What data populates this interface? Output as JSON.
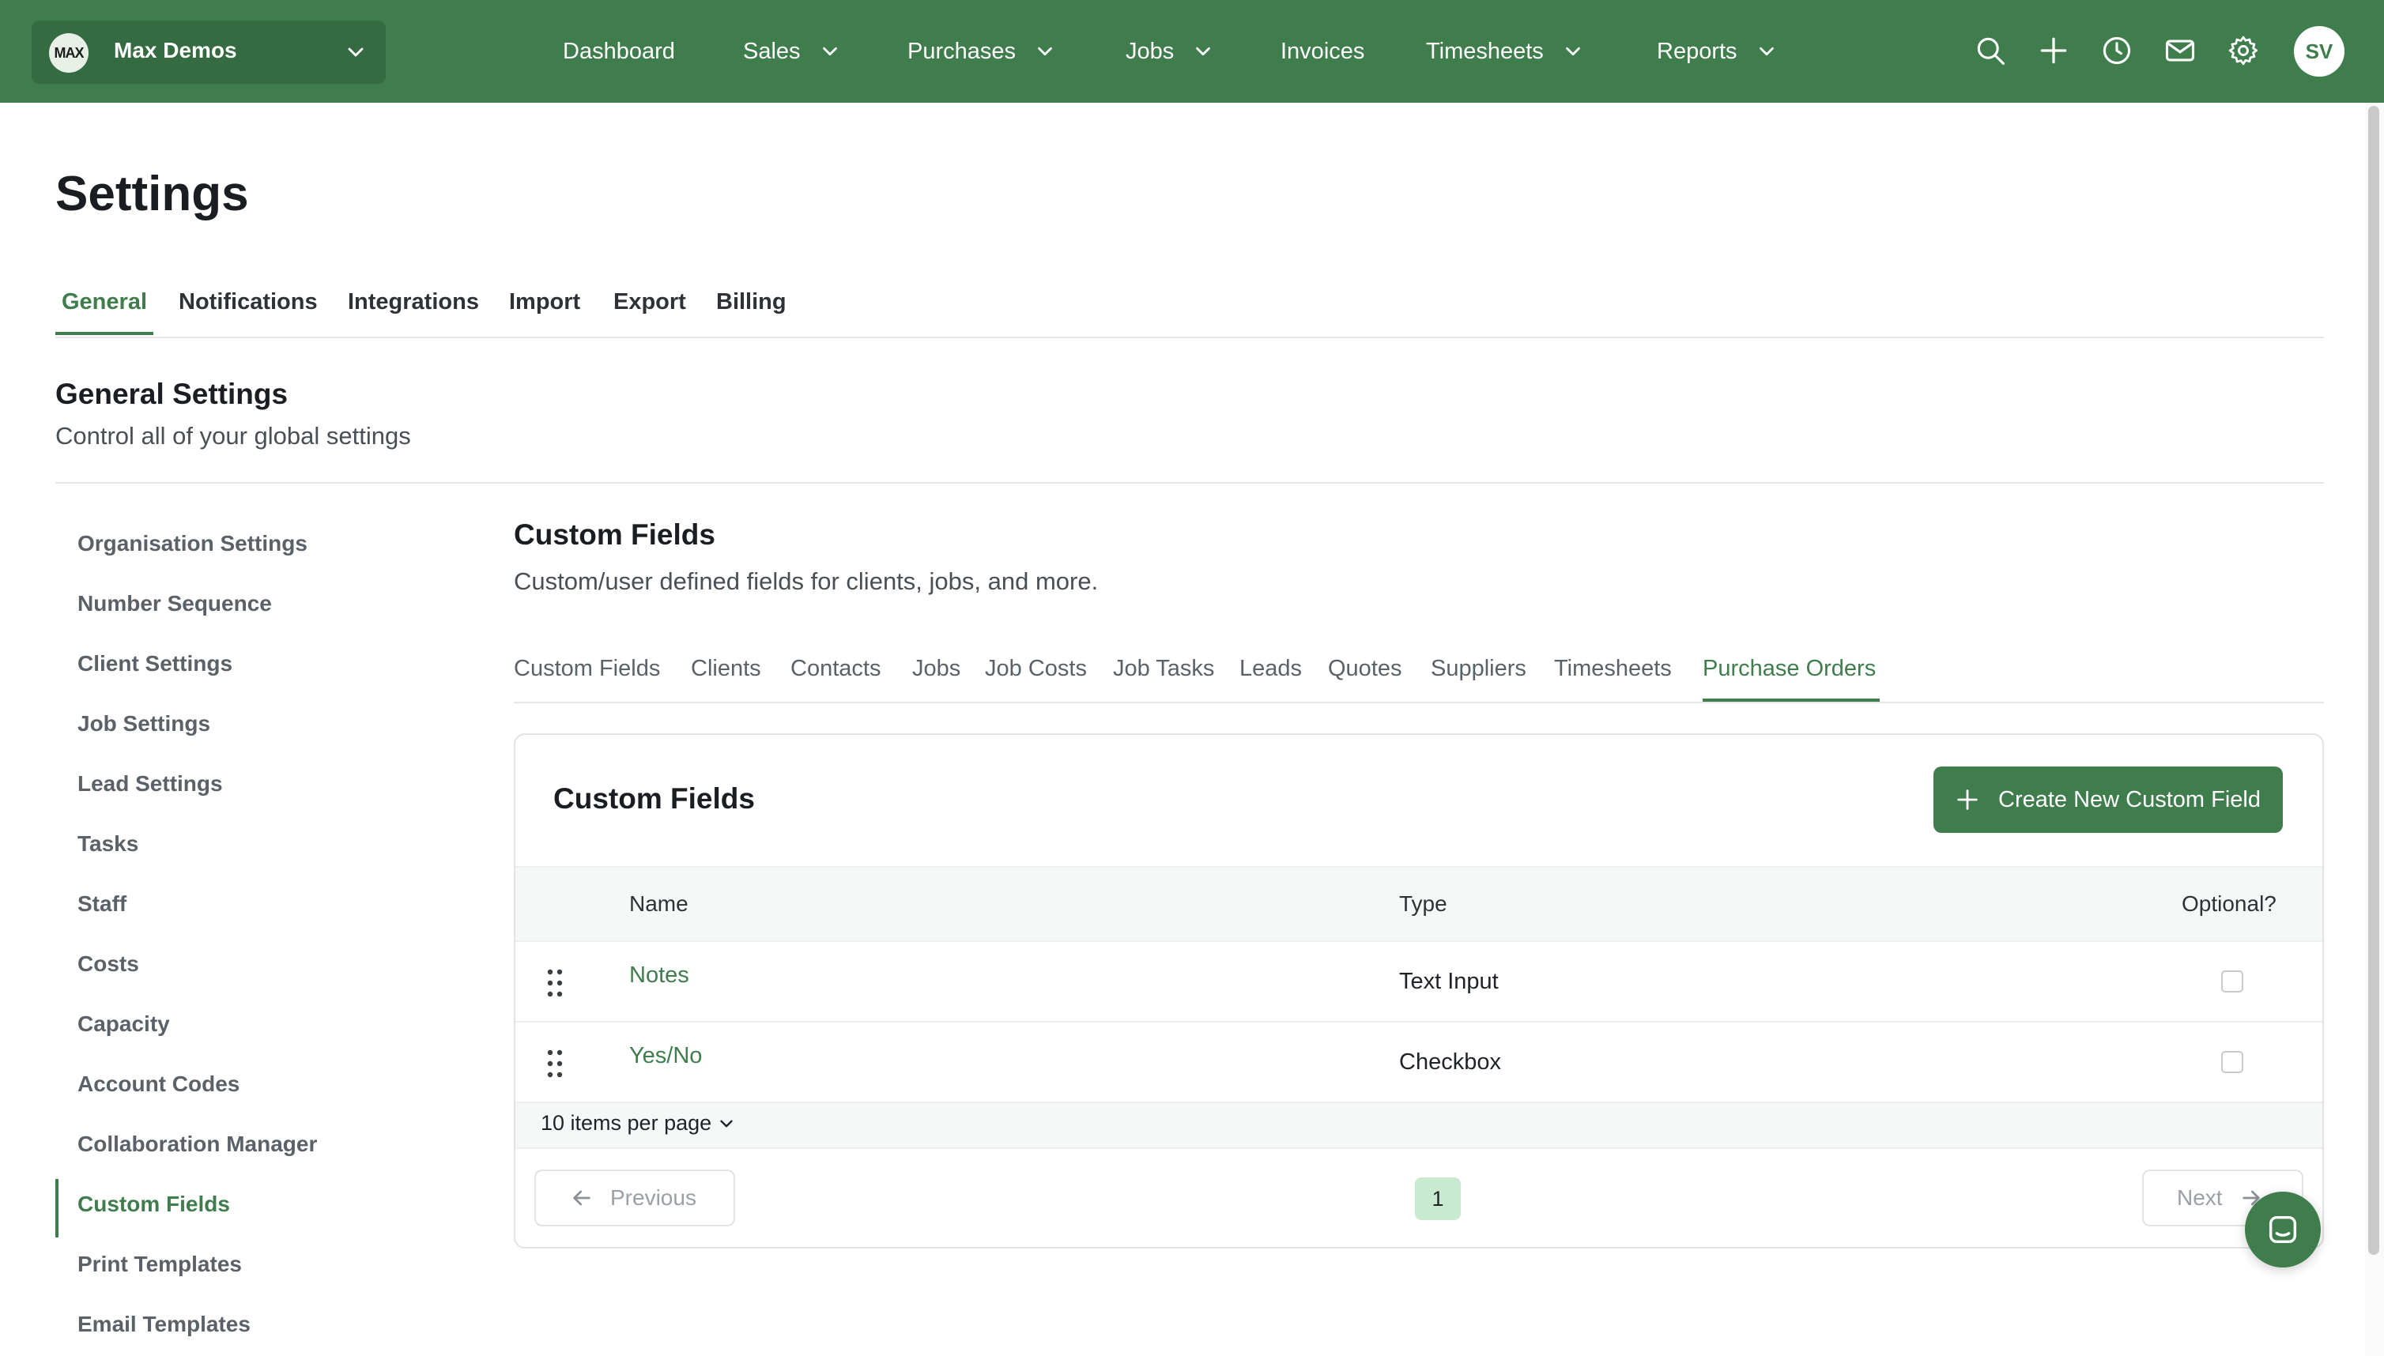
{
  "topbar": {
    "org_logo_text": "MAX",
    "org_name": "Max Demos",
    "nav": [
      {
        "label": "Dashboard",
        "dropdown": false
      },
      {
        "label": "Sales",
        "dropdown": true
      },
      {
        "label": "Purchases",
        "dropdown": true
      },
      {
        "label": "Jobs",
        "dropdown": true
      },
      {
        "label": "Invoices",
        "dropdown": false
      },
      {
        "label": "Timesheets",
        "dropdown": true
      },
      {
        "label": "Reports",
        "dropdown": true
      }
    ],
    "icons": [
      "search-icon",
      "plus-icon",
      "clock-icon",
      "mail-icon",
      "gear-icon"
    ],
    "avatar_initials": "SV",
    "bar_color": "#3f7d4d"
  },
  "page": {
    "title": "Settings",
    "tabs": [
      {
        "label": "General",
        "active": true
      },
      {
        "label": "Notifications"
      },
      {
        "label": "Integrations"
      },
      {
        "label": "Import"
      },
      {
        "label": "Export"
      },
      {
        "label": "Billing"
      }
    ],
    "section_title": "General Settings",
    "section_subtitle": "Control all of your global settings"
  },
  "sidebar": {
    "items": [
      {
        "label": "Organisation Settings"
      },
      {
        "label": "Number Sequence"
      },
      {
        "label": "Client Settings"
      },
      {
        "label": "Job Settings"
      },
      {
        "label": "Lead Settings"
      },
      {
        "label": "Tasks"
      },
      {
        "label": "Staff"
      },
      {
        "label": "Costs"
      },
      {
        "label": "Capacity"
      },
      {
        "label": "Account Codes"
      },
      {
        "label": "Collaboration Manager"
      },
      {
        "label": "Custom Fields",
        "active": true
      },
      {
        "label": "Print Templates"
      },
      {
        "label": "Email Templates"
      }
    ]
  },
  "custom_fields": {
    "title": "Custom Fields",
    "subtitle": "Custom/user defined fields for clients, jobs, and more.",
    "subtabs": [
      {
        "label": "Custom Fields"
      },
      {
        "label": "Clients"
      },
      {
        "label": "Contacts"
      },
      {
        "label": "Jobs"
      },
      {
        "label": "Job Costs"
      },
      {
        "label": "Job Tasks"
      },
      {
        "label": "Leads"
      },
      {
        "label": "Quotes"
      },
      {
        "label": "Suppliers"
      },
      {
        "label": "Timesheets"
      },
      {
        "label": "Purchase Orders",
        "active": true
      }
    ],
    "card": {
      "title": "Custom Fields",
      "create_button": "Create New Custom Field",
      "columns": {
        "name": "Name",
        "type": "Type",
        "optional": "Optional?"
      },
      "rows": [
        {
          "name": "Notes",
          "type": "Text Input",
          "optional": false
        },
        {
          "name": "Yes/No",
          "type": "Checkbox",
          "optional": false
        }
      ],
      "per_page": "10 items per page",
      "pagination": {
        "previous": "Previous",
        "next": "Next",
        "current_page": "1"
      }
    }
  }
}
